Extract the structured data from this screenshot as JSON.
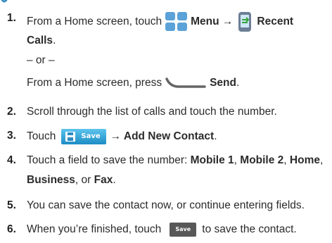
{
  "steps": [
    {
      "number": "1.",
      "line1": {
        "a": "From a Home screen, touch",
        "b": "Menu →",
        "c": "Recent"
      },
      "line2": "Calls",
      "line2_end": ".",
      "or": "– or –",
      "line4": {
        "a": "From a Home screen, press",
        "b": "Send",
        "c": "."
      }
    },
    {
      "number": "2.",
      "text": "Scroll through the list of calls and touch the number."
    },
    {
      "number": "3.",
      "a": "Touch",
      "button": "Save",
      "b": "→ Add New Contact",
      "c": "."
    },
    {
      "number": "4.",
      "a": "Touch a field to save the number: ",
      "f1": "Mobile 1",
      "s1": ", ",
      "f2": "Mobile 2",
      "s2": ", ",
      "f3": "Home",
      "s3": ",",
      "f4": "Business",
      "s4": ", or ",
      "f5": "Fax",
      "s5": "."
    },
    {
      "number": "5.",
      "text": "You can save the contact now, or continue entering fields."
    },
    {
      "number": "6.",
      "a": "When you’re finished, touch",
      "button": "Save",
      "b": "to save the contact."
    }
  ],
  "colors": {
    "accent": "#1d8cc4",
    "menu_grid": "#5aa2d8",
    "send_key": "#666666",
    "save_dark": "#585858"
  }
}
